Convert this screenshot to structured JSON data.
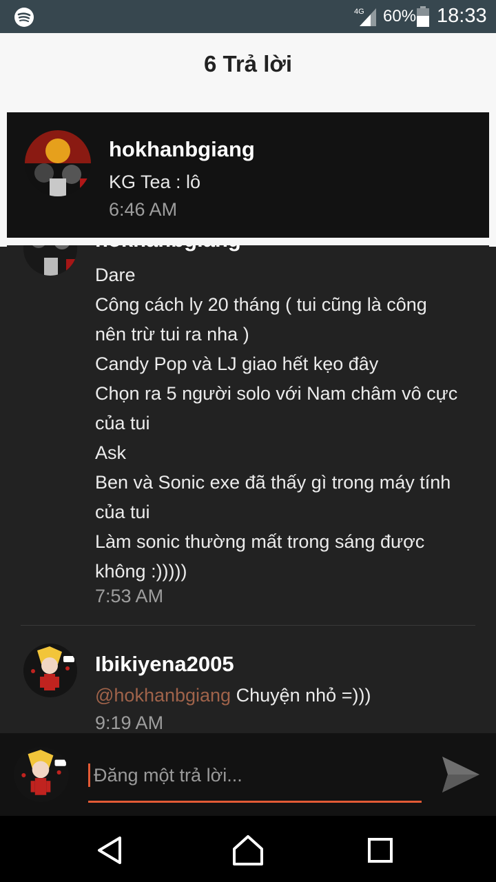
{
  "status_bar": {
    "network": "4G",
    "battery_percent": "60%",
    "time": "18:33"
  },
  "header": {
    "title": "6 Trả lời"
  },
  "top_post": {
    "username": "hokhanbgiang",
    "message": "KG Tea : lô",
    "time": "6:46 AM"
  },
  "thread": {
    "posts": [
      {
        "username": "hokhanbgiang",
        "lines": [
          "Dare",
          "Công cách ly 20 tháng ( tui cũng là công",
          "nên trừ tui ra nha )",
          "Candy Pop và LJ giao hết kẹo đây",
          "Chọn ra 5 người solo với Nam châm vô cực",
          "của tui",
          "Ask",
          "Ben và Sonic exe đã thấy gì trong máy tính",
          "của tui",
          "Làm sonic thường mất trong sáng được",
          "không :)))))"
        ],
        "time": "7:53 AM"
      },
      {
        "username": "Ibikiyena2005",
        "mention": "@hokhanbgiang",
        "message": " Chuyện nhỏ =)))",
        "time": "9:19 AM"
      }
    ]
  },
  "composer": {
    "placeholder": "Đăng một trả lời...",
    "value": ""
  },
  "icons": {
    "status": [
      "spotify-icon",
      "signal-icon",
      "battery-icon"
    ],
    "composer": [
      "send-icon"
    ],
    "nav": [
      "back-icon",
      "home-icon",
      "recents-icon"
    ]
  },
  "colors": {
    "status_bar": "#37474f",
    "accent": "#e35a35",
    "mention": "#a0634a",
    "card": "#121212",
    "background": "#222222"
  }
}
